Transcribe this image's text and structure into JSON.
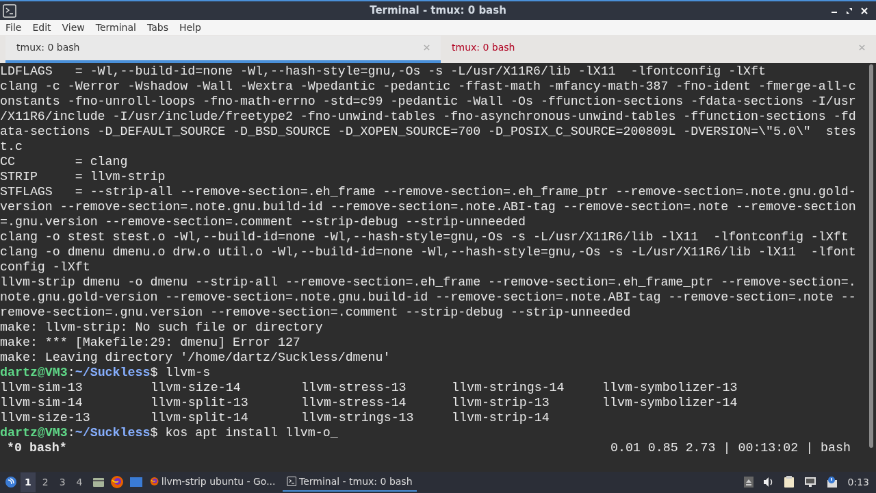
{
  "window": {
    "title": "Terminal - tmux: 0 bash"
  },
  "menu": [
    "File",
    "Edit",
    "View",
    "Terminal",
    "Tabs",
    "Help"
  ],
  "tabs": [
    {
      "label": "tmux: 0 bash",
      "selected": true,
      "alert": false
    },
    {
      "label": "tmux: 0 bash",
      "selected": false,
      "alert": true
    }
  ],
  "terminal": {
    "lines": [
      {
        "kind": "text",
        "text": "LDFLAGS   = -Wl,--build-id=none -Wl,--hash-style=gnu,-Os -s -L/usr/X11R6/lib -lX11  -lfontconfig -lXft"
      },
      {
        "kind": "text",
        "text": "clang -c -Werror -Wshadow -Wall -Wextra -Wpedantic -pedantic -ffast-math -mfancy-math-387 -fno-ident -fmerge-all-c"
      },
      {
        "kind": "text",
        "text": "onstants -fno-unroll-loops -fno-math-errno -std=c99 -pedantic -Wall -Os -ffunction-sections -fdata-sections -I/usr"
      },
      {
        "kind": "text",
        "text": "/X11R6/include -I/usr/include/freetype2 -fno-unwind-tables -fno-asynchronous-unwind-tables -ffunction-sections -fd"
      },
      {
        "kind": "text",
        "text": "ata-sections -D_DEFAULT_SOURCE -D_BSD_SOURCE -D_XOPEN_SOURCE=700 -D_POSIX_C_SOURCE=200809L -DVERSION=\\\"5.0\\\"  stes"
      },
      {
        "kind": "text",
        "text": "t.c"
      },
      {
        "kind": "text",
        "text": "CC        = clang"
      },
      {
        "kind": "text",
        "text": "STRIP     = llvm-strip"
      },
      {
        "kind": "text",
        "text": "STFLAGS   = --strip-all --remove-section=.eh_frame --remove-section=.eh_frame_ptr --remove-section=.note.gnu.gold-"
      },
      {
        "kind": "text",
        "text": "version --remove-section=.note.gnu.build-id --remove-section=.note.ABI-tag --remove-section=.note --remove-section"
      },
      {
        "kind": "text",
        "text": "=.gnu.version --remove-section=.comment --strip-debug --strip-unneeded"
      },
      {
        "kind": "text",
        "text": "clang -o stest stest.o -Wl,--build-id=none -Wl,--hash-style=gnu,-Os -s -L/usr/X11R6/lib -lX11  -lfontconfig -lXft"
      },
      {
        "kind": "text",
        "text": "clang -o dmenu dmenu.o drw.o util.o -Wl,--build-id=none -Wl,--hash-style=gnu,-Os -s -L/usr/X11R6/lib -lX11  -lfont"
      },
      {
        "kind": "text",
        "text": "config -lXft"
      },
      {
        "kind": "text",
        "text": "llvm-strip dmenu -o dmenu --strip-all --remove-section=.eh_frame --remove-section=.eh_frame_ptr --remove-section=."
      },
      {
        "kind": "text",
        "text": "note.gnu.gold-version --remove-section=.note.gnu.build-id --remove-section=.note.ABI-tag --remove-section=.note --"
      },
      {
        "kind": "text",
        "text": "remove-section=.gnu.version --remove-section=.comment --strip-debug --strip-unneeded"
      },
      {
        "kind": "text",
        "text": "make: llvm-strip: No such file or directory"
      },
      {
        "kind": "text",
        "text": "make: *** [Makefile:29: dmenu] Error 127"
      },
      {
        "kind": "text",
        "text": "make: Leaving directory '/home/dartz/Suckless/dmenu'"
      },
      {
        "kind": "prompt",
        "user": "dartz@VM3",
        "sep": ":",
        "path": "~/Suckless",
        "command": "$ llvm-s"
      },
      {
        "kind": "columns",
        "items": [
          "llvm-sim-13",
          "llvm-size-14",
          "llvm-stress-13",
          "llvm-strings-14",
          "llvm-symbolizer-13"
        ]
      },
      {
        "kind": "columns",
        "items": [
          "llvm-sim-14",
          "llvm-split-13",
          "llvm-stress-14",
          "llvm-strip-13",
          "llvm-symbolizer-14"
        ]
      },
      {
        "kind": "columns",
        "items": [
          "llvm-size-13",
          "llvm-split-14",
          "llvm-strings-13",
          "llvm-strip-14"
        ]
      },
      {
        "kind": "prompt",
        "user": "dartz@VM3",
        "sep": ":",
        "path": "~/Suckless",
        "command": "$ kos apt install llvm-o",
        "cursor": "_"
      }
    ],
    "status": {
      "left": "*0 bash*",
      "right": "0.01 0.85 2.73 | 00:13:02 | bash"
    }
  },
  "taskbar": {
    "workspaces": [
      {
        "label": "1",
        "selected": true
      },
      {
        "label": "2",
        "selected": false
      },
      {
        "label": "3",
        "selected": false
      },
      {
        "label": "4",
        "selected": false
      }
    ],
    "tasks": [
      {
        "label": "llvm-strip ubuntu - Go...",
        "kind": "browser",
        "selected": false
      },
      {
        "label": "Terminal - tmux: 0 bash",
        "kind": "terminal",
        "selected": true
      }
    ],
    "clock": "0:13"
  }
}
